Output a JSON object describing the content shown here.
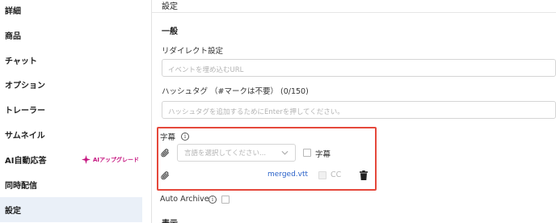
{
  "sidebar": {
    "items": [
      {
        "label": "詳細"
      },
      {
        "label": "商品"
      },
      {
        "label": "チャット"
      },
      {
        "label": "オプション"
      },
      {
        "label": "トレーラー"
      },
      {
        "label": "サムネイル"
      },
      {
        "label": "AI自動応答",
        "badge": "AIアップグレード"
      },
      {
        "label": "同時配信"
      },
      {
        "label": "設定",
        "active": true
      }
    ]
  },
  "main": {
    "header": "設定",
    "section_title": "一般",
    "redirect": {
      "label": "リダイレクト設定",
      "placeholder": "イベントを埋め込むURL"
    },
    "hashtag": {
      "label": "ハッシュタグ （#マークは不要） (0/150)",
      "placeholder": "ハッシュタグを追加するためにEnterを押してください。"
    },
    "subtitle": {
      "label": "字幕",
      "language_placeholder": "言語を選択してください...",
      "checkbox_label": "字幕",
      "file_name": "merged.vtt",
      "cc_label": "CC"
    },
    "auto_archive": {
      "label": "Auto Archive"
    },
    "next_section": "表示"
  },
  "colors": {
    "highlight_border": "#e5483b",
    "active_item_bg": "#eaf0f8",
    "link": "#2a62c9",
    "upgrade_badge": "#c5147f"
  },
  "icons": [
    "info-icon",
    "paperclip-icon",
    "chevron-down-icon",
    "trash-icon",
    "sparkle-icon"
  ]
}
